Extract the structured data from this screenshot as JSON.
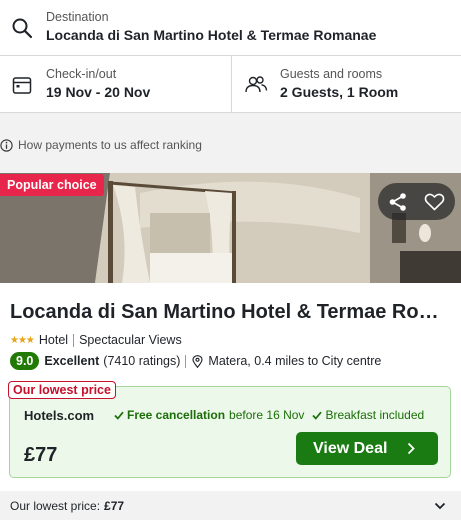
{
  "search": {
    "destination_label": "Destination",
    "destination_value": "Locanda di San Martino Hotel & Termae Romanae",
    "dates_label": "Check-in/out",
    "dates_value": "19 Nov - 20 Nov",
    "guests_label": "Guests and rooms",
    "guests_value": "2 Guests, 1 Room"
  },
  "ranking_note": "How payments to us affect ranking",
  "hotel": {
    "badge": "Popular choice",
    "name": "Locanda di San Martino Hotel & Termae Rom...",
    "stars": "★★★",
    "star_rating": 3,
    "type": "Hotel",
    "feature": "Spectacular Views",
    "score": "9.0",
    "score_word": "Excellent",
    "ratings_count": "(7410 ratings)",
    "location": "Matera, 0.4 miles to City centre"
  },
  "deal": {
    "tag": "Our lowest price",
    "provider": "Hotels.com",
    "cancel_strong": "Free cancellation",
    "cancel_rest": "before 16 Nov",
    "breakfast": "Breakfast included",
    "price": "£77",
    "button_label": "View Deal"
  },
  "summary": {
    "label": "Our lowest price:",
    "value": "£77"
  },
  "colors": {
    "badge_red": "#e8254b",
    "score_green": "#227a06",
    "deal_button": "#1a7b12",
    "deal_bg": "#ecf8e9"
  },
  "icons": [
    "search-icon",
    "calendar-icon",
    "guests-icon",
    "info-icon",
    "share-icon",
    "heart-icon",
    "location-pin-icon",
    "check-icon",
    "chevron-right-icon",
    "chevron-down-icon"
  ]
}
